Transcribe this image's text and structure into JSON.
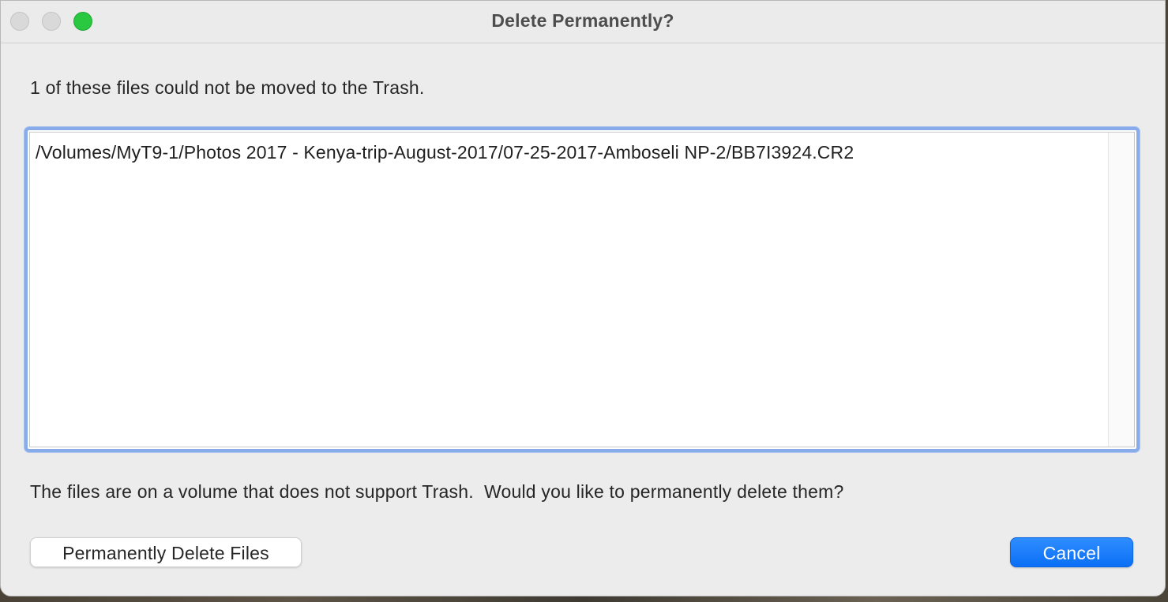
{
  "window": {
    "title": "Delete Permanently?"
  },
  "dialog": {
    "message": "1 of these files could not be moved to the Trash.",
    "files": [
      "/Volumes/MyT9-1/Photos 2017 - Kenya-trip-August-2017/07-25-2017-Amboseli NP-2/BB7I3924.CR2"
    ],
    "info": "The files are on a volume that does not support Trash.  Would you like to permanently delete them?",
    "delete_button_label": "Permanently Delete Files",
    "cancel_button_label": "Cancel"
  },
  "colors": {
    "accent": "#0a6ff5",
    "focus_ring": "#88acea",
    "zoom_button": "#2ac840"
  },
  "icons": {
    "close": "close-button",
    "minimize": "minimize-button",
    "zoom": "zoom-button"
  }
}
